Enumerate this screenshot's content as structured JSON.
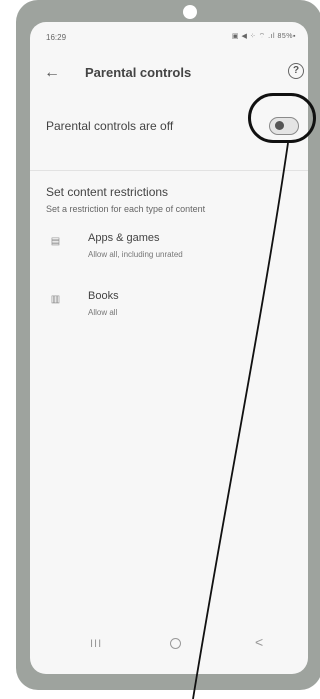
{
  "status_bar": {
    "time": "16:29",
    "icons_text": "▣ ◀ ⁘ ⌔ .ıl 85%▪"
  },
  "app_bar": {
    "title": "Parental controls",
    "back_icon": "←",
    "help_icon": "?"
  },
  "toggle_row": {
    "label": "Parental controls are off",
    "state": "off"
  },
  "restrictions": {
    "title": "Set content restrictions",
    "subtitle": "Set a restriction for each type of content"
  },
  "items": [
    {
      "title": "Apps & games",
      "subtitle": "Allow all, including unrated",
      "icon": "apps-games-icon"
    },
    {
      "title": "Books",
      "subtitle": "Allow all",
      "icon": "book-icon"
    }
  ],
  "nav_bar": {
    "recents": "III",
    "back": "<"
  }
}
